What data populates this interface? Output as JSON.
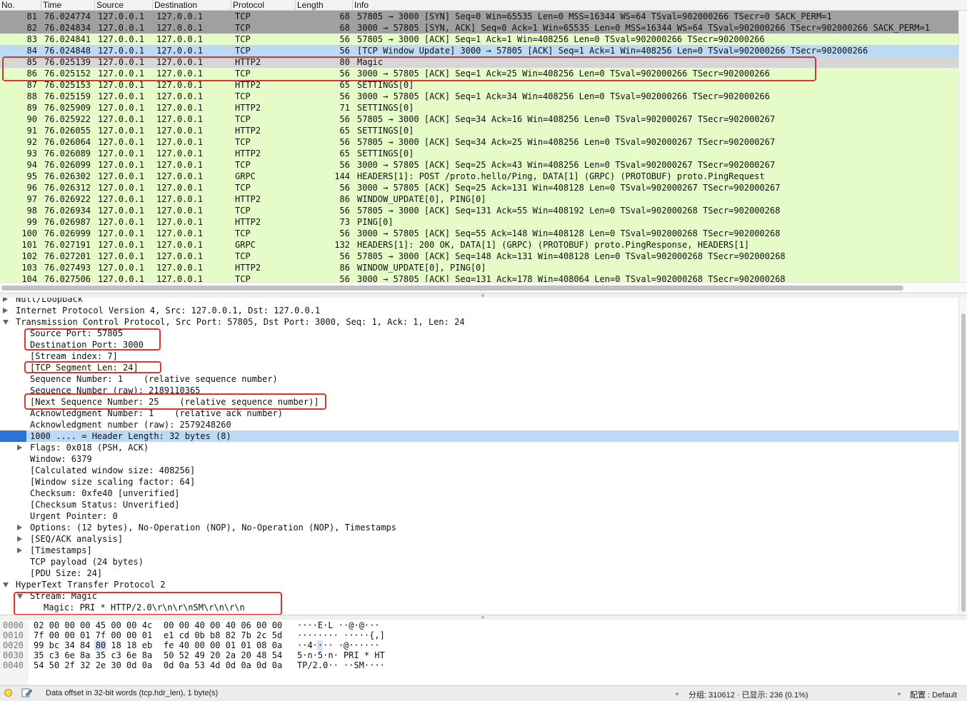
{
  "columns": [
    "No.",
    "Time",
    "Source",
    "Destination",
    "Protocol",
    "Length",
    "Info"
  ],
  "colors": {
    "tcp_syn_gray": "#a0a0a0",
    "tcp_update_blue": "#bcd9f6",
    "http2_green": "#e5fbc8",
    "tcp_green": "#e5fbc8",
    "selected_gray": "#d6d6d6",
    "highlight_blue": "#bcd9f6",
    "annotation_red": "#e0352b"
  },
  "packets": [
    {
      "no": "81",
      "time": "76.024774",
      "src": "127.0.0.1",
      "dst": "127.0.0.1",
      "proto": "TCP",
      "len": "68",
      "info": "57805 → 3000 [SYN] Seq=0 Win=65535 Len=0 MSS=16344 WS=64 TSval=902000266 TSecr=0 SACK_PERM=1",
      "style": "gray"
    },
    {
      "no": "82",
      "time": "76.024834",
      "src": "127.0.0.1",
      "dst": "127.0.0.1",
      "proto": "TCP",
      "len": "68",
      "info": "3000 → 57805 [SYN, ACK] Seq=0 Ack=1 Win=65535 Len=0 MSS=16344 WS=64 TSval=902000266 TSecr=902000266 SACK_PERM=1",
      "style": "gray"
    },
    {
      "no": "83",
      "time": "76.024841",
      "src": "127.0.0.1",
      "dst": "127.0.0.1",
      "proto": "TCP",
      "len": "56",
      "info": "57805 → 3000 [ACK] Seq=1 Ack=1 Win=408256 Len=0 TSval=902000266 TSecr=902000266",
      "style": "green"
    },
    {
      "no": "84",
      "time": "76.024848",
      "src": "127.0.0.1",
      "dst": "127.0.0.1",
      "proto": "TCP",
      "len": "56",
      "info": "[TCP Window Update] 3000 → 57805 [ACK] Seq=1 Ack=1 Win=408256 Len=0 TSval=902000266 TSecr=902000266",
      "style": "blue"
    },
    {
      "no": "85",
      "time": "76.025139",
      "src": "127.0.0.1",
      "dst": "127.0.0.1",
      "proto": "HTTP2",
      "len": "80",
      "info": "Magic",
      "style": "selected"
    },
    {
      "no": "86",
      "time": "76.025152",
      "src": "127.0.0.1",
      "dst": "127.0.0.1",
      "proto": "TCP",
      "len": "56",
      "info": "3000 → 57805 [ACK] Seq=1 Ack=25 Win=408256 Len=0 TSval=902000266 TSecr=902000266",
      "style": "green"
    },
    {
      "no": "87",
      "time": "76.025153",
      "src": "127.0.0.1",
      "dst": "127.0.0.1",
      "proto": "HTTP2",
      "len": "65",
      "info": "SETTINGS[0]",
      "style": "green"
    },
    {
      "no": "88",
      "time": "76.025159",
      "src": "127.0.0.1",
      "dst": "127.0.0.1",
      "proto": "TCP",
      "len": "56",
      "info": "3000 → 57805 [ACK] Seq=1 Ack=34 Win=408256 Len=0 TSval=902000266 TSecr=902000266",
      "style": "green"
    },
    {
      "no": "89",
      "time": "76.025909",
      "src": "127.0.0.1",
      "dst": "127.0.0.1",
      "proto": "HTTP2",
      "len": "71",
      "info": "SETTINGS[0]",
      "style": "green"
    },
    {
      "no": "90",
      "time": "76.025922",
      "src": "127.0.0.1",
      "dst": "127.0.0.1",
      "proto": "TCP",
      "len": "56",
      "info": "57805 → 3000 [ACK] Seq=34 Ack=16 Win=408256 Len=0 TSval=902000267 TSecr=902000267",
      "style": "green"
    },
    {
      "no": "91",
      "time": "76.026055",
      "src": "127.0.0.1",
      "dst": "127.0.0.1",
      "proto": "HTTP2",
      "len": "65",
      "info": "SETTINGS[0]",
      "style": "green"
    },
    {
      "no": "92",
      "time": "76.026064",
      "src": "127.0.0.1",
      "dst": "127.0.0.1",
      "proto": "TCP",
      "len": "56",
      "info": "57805 → 3000 [ACK] Seq=34 Ack=25 Win=408256 Len=0 TSval=902000267 TSecr=902000267",
      "style": "green"
    },
    {
      "no": "93",
      "time": "76.026089",
      "src": "127.0.0.1",
      "dst": "127.0.0.1",
      "proto": "HTTP2",
      "len": "65",
      "info": "SETTINGS[0]",
      "style": "green"
    },
    {
      "no": "94",
      "time": "76.026099",
      "src": "127.0.0.1",
      "dst": "127.0.0.1",
      "proto": "TCP",
      "len": "56",
      "info": "3000 → 57805 [ACK] Seq=25 Ack=43 Win=408256 Len=0 TSval=902000267 TSecr=902000267",
      "style": "green"
    },
    {
      "no": "95",
      "time": "76.026302",
      "src": "127.0.0.1",
      "dst": "127.0.0.1",
      "proto": "GRPC",
      "len": "144",
      "info": "HEADERS[1]: POST /proto.hello/Ping, DATA[1] (GRPC) (PROTOBUF) proto.PingRequest",
      "style": "green"
    },
    {
      "no": "96",
      "time": "76.026312",
      "src": "127.0.0.1",
      "dst": "127.0.0.1",
      "proto": "TCP",
      "len": "56",
      "info": "3000 → 57805 [ACK] Seq=25 Ack=131 Win=408128 Len=0 TSval=902000267 TSecr=902000267",
      "style": "green"
    },
    {
      "no": "97",
      "time": "76.026922",
      "src": "127.0.0.1",
      "dst": "127.0.0.1",
      "proto": "HTTP2",
      "len": "86",
      "info": "WINDOW_UPDATE[0], PING[0]",
      "style": "green"
    },
    {
      "no": "98",
      "time": "76.026934",
      "src": "127.0.0.1",
      "dst": "127.0.0.1",
      "proto": "TCP",
      "len": "56",
      "info": "57805 → 3000 [ACK] Seq=131 Ack=55 Win=408192 Len=0 TSval=902000268 TSecr=902000268",
      "style": "green"
    },
    {
      "no": "99",
      "time": "76.026987",
      "src": "127.0.0.1",
      "dst": "127.0.0.1",
      "proto": "HTTP2",
      "len": "73",
      "info": "PING[0]",
      "style": "green"
    },
    {
      "no": "100",
      "time": "76.026999",
      "src": "127.0.0.1",
      "dst": "127.0.0.1",
      "proto": "TCP",
      "len": "56",
      "info": "3000 → 57805 [ACK] Seq=55 Ack=148 Win=408128 Len=0 TSval=902000268 TSecr=902000268",
      "style": "green"
    },
    {
      "no": "101",
      "time": "76.027191",
      "src": "127.0.0.1",
      "dst": "127.0.0.1",
      "proto": "GRPC",
      "len": "132",
      "info": "HEADERS[1]: 200 OK, DATA[1] (GRPC) (PROTOBUF) proto.PingResponse, HEADERS[1]",
      "style": "green"
    },
    {
      "no": "102",
      "time": "76.027201",
      "src": "127.0.0.1",
      "dst": "127.0.0.1",
      "proto": "TCP",
      "len": "56",
      "info": "57805 → 3000 [ACK] Seq=148 Ack=131 Win=408128 Len=0 TSval=902000268 TSecr=902000268",
      "style": "green"
    },
    {
      "no": "103",
      "time": "76.027493",
      "src": "127.0.0.1",
      "dst": "127.0.0.1",
      "proto": "HTTP2",
      "len": "86",
      "info": "WINDOW_UPDATE[0], PING[0]",
      "style": "green"
    },
    {
      "no": "104",
      "time": "76.027506",
      "src": "127.0.0.1",
      "dst": "127.0.0.1",
      "proto": "TCP",
      "len": "56",
      "info": "3000 → 57805 [ACK] Seq=131 Ack=178 Win=408064 Len=0 TSval=902000268 TSecr=902000268",
      "style": "green"
    }
  ],
  "details": [
    {
      "indent": 0,
      "tri": "right",
      "text": "Null/Loopback"
    },
    {
      "indent": 0,
      "tri": "right",
      "text": "Internet Protocol Version 4, Src: 127.0.0.1, Dst: 127.0.0.1"
    },
    {
      "indent": 0,
      "tri": "down",
      "text": "Transmission Control Protocol, Src Port: 57805, Dst Port: 3000, Seq: 1, Ack: 1, Len: 24"
    },
    {
      "indent": 1,
      "tri": "",
      "text": "Source Port: 57805"
    },
    {
      "indent": 1,
      "tri": "",
      "text": "Destination Port: 3000"
    },
    {
      "indent": 1,
      "tri": "",
      "text": "[Stream index: 7]"
    },
    {
      "indent": 1,
      "tri": "",
      "text": "[TCP Segment Len: 24]"
    },
    {
      "indent": 1,
      "tri": "",
      "text": "Sequence Number: 1    (relative sequence number)"
    },
    {
      "indent": 1,
      "tri": "",
      "text": "Sequence Number (raw): 2189110365"
    },
    {
      "indent": 1,
      "tri": "",
      "text": "[Next Sequence Number: 25    (relative sequence number)]"
    },
    {
      "indent": 1,
      "tri": "",
      "text": "Acknowledgment Number: 1    (relative ack number)"
    },
    {
      "indent": 1,
      "tri": "",
      "text": "Acknowledgment number (raw): 2579248260"
    },
    {
      "indent": 1,
      "tri": "",
      "text": "1000 .... = Header Length: 32 bytes (8)",
      "selected": true
    },
    {
      "indent": 1,
      "tri": "right",
      "text": "Flags: 0x018 (PSH, ACK)"
    },
    {
      "indent": 1,
      "tri": "",
      "text": "Window: 6379"
    },
    {
      "indent": 1,
      "tri": "",
      "text": "[Calculated window size: 408256]"
    },
    {
      "indent": 1,
      "tri": "",
      "text": "[Window size scaling factor: 64]"
    },
    {
      "indent": 1,
      "tri": "",
      "text": "Checksum: 0xfe40 [unverified]"
    },
    {
      "indent": 1,
      "tri": "",
      "text": "[Checksum Status: Unverified]"
    },
    {
      "indent": 1,
      "tri": "",
      "text": "Urgent Pointer: 0"
    },
    {
      "indent": 1,
      "tri": "right",
      "text": "Options: (12 bytes), No-Operation (NOP), No-Operation (NOP), Timestamps"
    },
    {
      "indent": 1,
      "tri": "right",
      "text": "[SEQ/ACK analysis]"
    },
    {
      "indent": 1,
      "tri": "right",
      "text": "[Timestamps]"
    },
    {
      "indent": 1,
      "tri": "",
      "text": "TCP payload (24 bytes)"
    },
    {
      "indent": 1,
      "tri": "",
      "text": "[PDU Size: 24]"
    },
    {
      "indent": 0,
      "tri": "down",
      "text": "HyperText Transfer Protocol 2"
    },
    {
      "indent": 1,
      "tri": "down",
      "text": "Stream: Magic"
    },
    {
      "indent": 2,
      "tri": "",
      "text": "Magic: PRI * HTTP/2.0\\r\\n\\r\\nSM\\r\\n\\r\\n"
    }
  ],
  "bytes": [
    {
      "off": "0000",
      "hex_a": "02 00 00 00 45 00 00 4c",
      "hex_b": "00 00 40 00 40 06 00 00",
      "ascii": "····E·L ··@·@···"
    },
    {
      "off": "0010",
      "hex_a": "7f 00 00 01 7f 00 00 01",
      "hex_b": "e1 cd 0b b8 82 7b 2c 5d",
      "ascii": "········ ·····{,]"
    },
    {
      "off": "0020",
      "hex_a": "99 bc 34 84 80 18 18 eb",
      "hex_b": "fe 40 00 00 01 01 08 0a",
      "ascii": "··4···· ·@······"
    },
    {
      "off": "0030",
      "hex_a": "35 c3 6e 8a 35 c3 6e 8a",
      "hex_b": "50 52 49 20 2a 20 48 54",
      "ascii": "5·n·5·n· PRI * HT"
    },
    {
      "off": "0040",
      "hex_a": "54 50 2f 32 2e 30 0d 0a",
      "hex_b": "0d 0a 53 4d 0d 0a 0d 0a",
      "ascii": "TP/2.0·· ··SM····"
    }
  ],
  "status": {
    "field_info": "Data offset in 32-bit words (tcp.hdr_len), 1 byte(s)",
    "packets": "分组: 310612 · 已显示: 236 (0.1%)",
    "profile": "配置 : Default"
  }
}
